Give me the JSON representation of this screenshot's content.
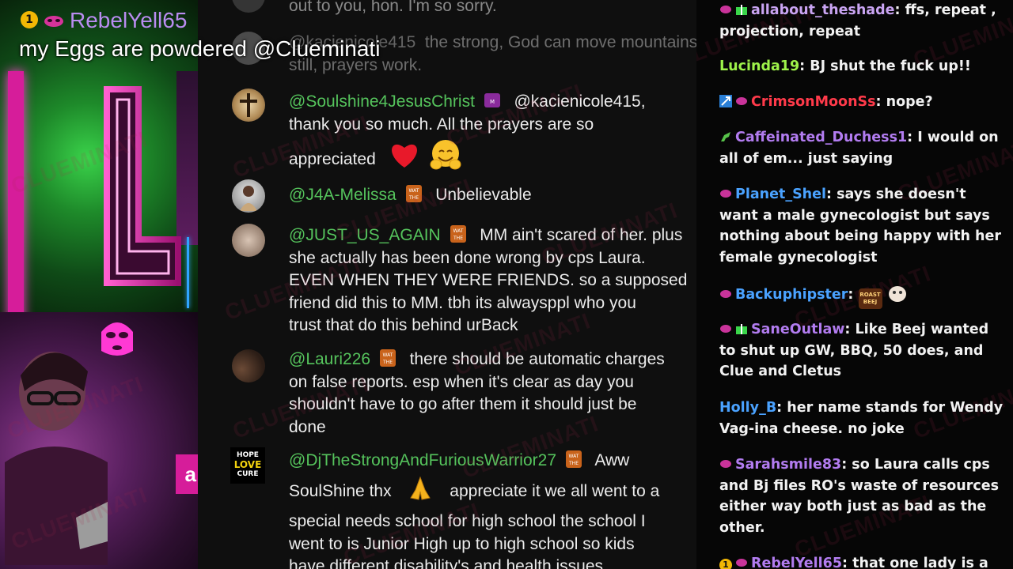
{
  "highlight": {
    "badge": "1",
    "username": "RebelYell65",
    "text": "my Eggs are powdered @Clueminati"
  },
  "left_panel": {
    "pink_box_char": "a"
  },
  "watermark": "CLUEMINATI",
  "comments": [
    {
      "name": "",
      "text": "out to you, hon. I'm so sorry.",
      "faded": true
    },
    {
      "name": "@kacienicole415",
      "text": "the strong, God can move mountains still, prayers work.",
      "faded": true
    },
    {
      "name": "@Soulshine4JesusChrist",
      "line1": "@kacienicole415,",
      "line2": "thank you so much. All the prayers are so",
      "line3": "appreciated"
    },
    {
      "name": "@J4A-Melissa",
      "text": "Unbelievable"
    },
    {
      "name": "@JUST_US_AGAIN",
      "line1": "MM ain't scared of her. plus",
      "line2": "she actually has been done wrong by cps Laura.",
      "line3": "EVEN WHEN THEY WERE FRIENDS. so a supposed",
      "line4": "friend did this to MM. tbh its alwaysppl who you",
      "line5": "trust that do this behind urBack"
    },
    {
      "name": "@Lauri226",
      "line1": "there should be automatic charges",
      "line2": "on false reports. esp when it's clear as day you",
      "line3": "shouldn't have to go after them it should just be",
      "line4": "done"
    },
    {
      "name": "@DjTheStrongAndFuriousWarrior27",
      "line1": "Aww",
      "line2a": "SoulShine thx",
      "line2b": "appreciate it we all went to a",
      "line3": "special needs school for high school the school I",
      "line4": "went to is Junior High up to high school so kids",
      "line5": "have different disability's and health issues",
      "avatar_text": [
        "HOPE",
        "LOVE",
        "CURE"
      ]
    }
  ],
  "chat": [
    {
      "user": "allabout_theshade",
      "color": "#c9a4f2",
      "text": "ffs, repeat , projection, repeat",
      "badges": [
        "crown-icon",
        "gift-icon"
      ]
    },
    {
      "user": "Lucinda19",
      "color": "#9ef24a",
      "text": "BJ shut the fuck up!!",
      "badges": []
    },
    {
      "user": "CrimsonMoonSs",
      "color": "#ff3a4a",
      "text": "nope?",
      "badges": [
        "pin-icon",
        "crown-icon"
      ]
    },
    {
      "user": "Caffeinated_Duchess1",
      "color": "#b27cf0",
      "text": "I would on all of em... just saying",
      "badges": [
        "dino-icon"
      ]
    },
    {
      "user": "Planet_Shel",
      "color": "#4aa2ff",
      "text": "says she doesn't want a male gynecologist but says nothing about being happy with her female gynecologist",
      "badges": [
        "crown-icon"
      ]
    },
    {
      "user": "Backuphipster",
      "color": "#4aa2ff",
      "text": "",
      "badges": [
        "crown-icon"
      ],
      "emote_text": "ROAST BEEJ"
    },
    {
      "user": "SaneOutlaw",
      "color": "#b27cf0",
      "text": "Like Beej wanted to shut up GW, BBQ, 50 does, and Clue and Cletus",
      "badges": [
        "crown-icon",
        "gift-icon"
      ]
    },
    {
      "user": "Holly_B",
      "color": "#4aa2ff",
      "text": "her name stands for Wendy Vag-ina cheese. no joke",
      "badges": []
    },
    {
      "user": "Sarahsmile83",
      "color": "#b27cf0",
      "text": "so Laura calls cps and Bj files RO's waste of resources either way both just as bad as the other.",
      "badges": [
        "crown-icon"
      ]
    },
    {
      "user": "RebelYell65",
      "color": "#b27cf0",
      "text": "that one lady is a",
      "badges": [
        "number-one-icon",
        "crown-icon"
      ],
      "num": "1"
    }
  ]
}
